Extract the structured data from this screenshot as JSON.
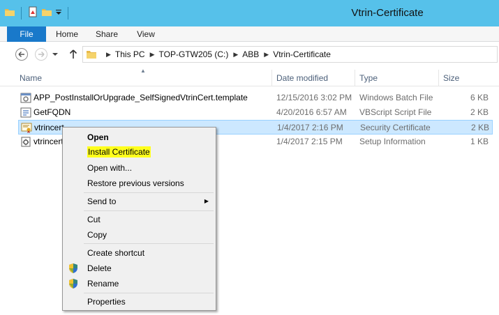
{
  "window": {
    "title": "Vtrin-Certificate"
  },
  "ribbon": {
    "tabs": [
      "File",
      "Home",
      "Share",
      "View"
    ]
  },
  "address": {
    "crumbs": [
      "This PC",
      "TOP-GTW205 (C:)",
      "ABB",
      "Vtrin-Certificate"
    ]
  },
  "columns": {
    "name": "Name",
    "date": "Date modified",
    "type": "Type",
    "size": "Size"
  },
  "files": [
    {
      "name": "APP_PostInstallOrUpgrade_SelfSignedVtrinCert.template",
      "date": "12/15/2016 3:02 PM",
      "type": "Windows Batch File",
      "size": "6 KB",
      "icon": "batch-file-icon"
    },
    {
      "name": "GetFQDN",
      "date": "4/20/2016 6:57 AM",
      "type": "VBScript Script File",
      "size": "2 KB",
      "icon": "vbscript-file-icon"
    },
    {
      "name": "vtrincert",
      "date": "1/4/2017 2:16 PM",
      "type": "Security Certificate",
      "size": "2 KB",
      "icon": "certificate-file-icon",
      "selected": true
    },
    {
      "name": "vtrincert",
      "date": "1/4/2017 2:15 PM",
      "type": "Setup Information",
      "size": "1 KB",
      "icon": "setup-info-file-icon"
    }
  ],
  "context_menu": {
    "open": "Open",
    "install_certificate": "Install Certificate",
    "open_with": "Open with...",
    "restore_previous": "Restore previous versions",
    "send_to": "Send to",
    "cut": "Cut",
    "copy": "Copy",
    "create_shortcut": "Create shortcut",
    "delete": "Delete",
    "rename": "Rename",
    "properties": "Properties"
  },
  "colors": {
    "titlebar": "#56c1ea",
    "file_tab": "#1979ca",
    "selection": "#cce8ff",
    "highlight": "#ffff1c"
  }
}
